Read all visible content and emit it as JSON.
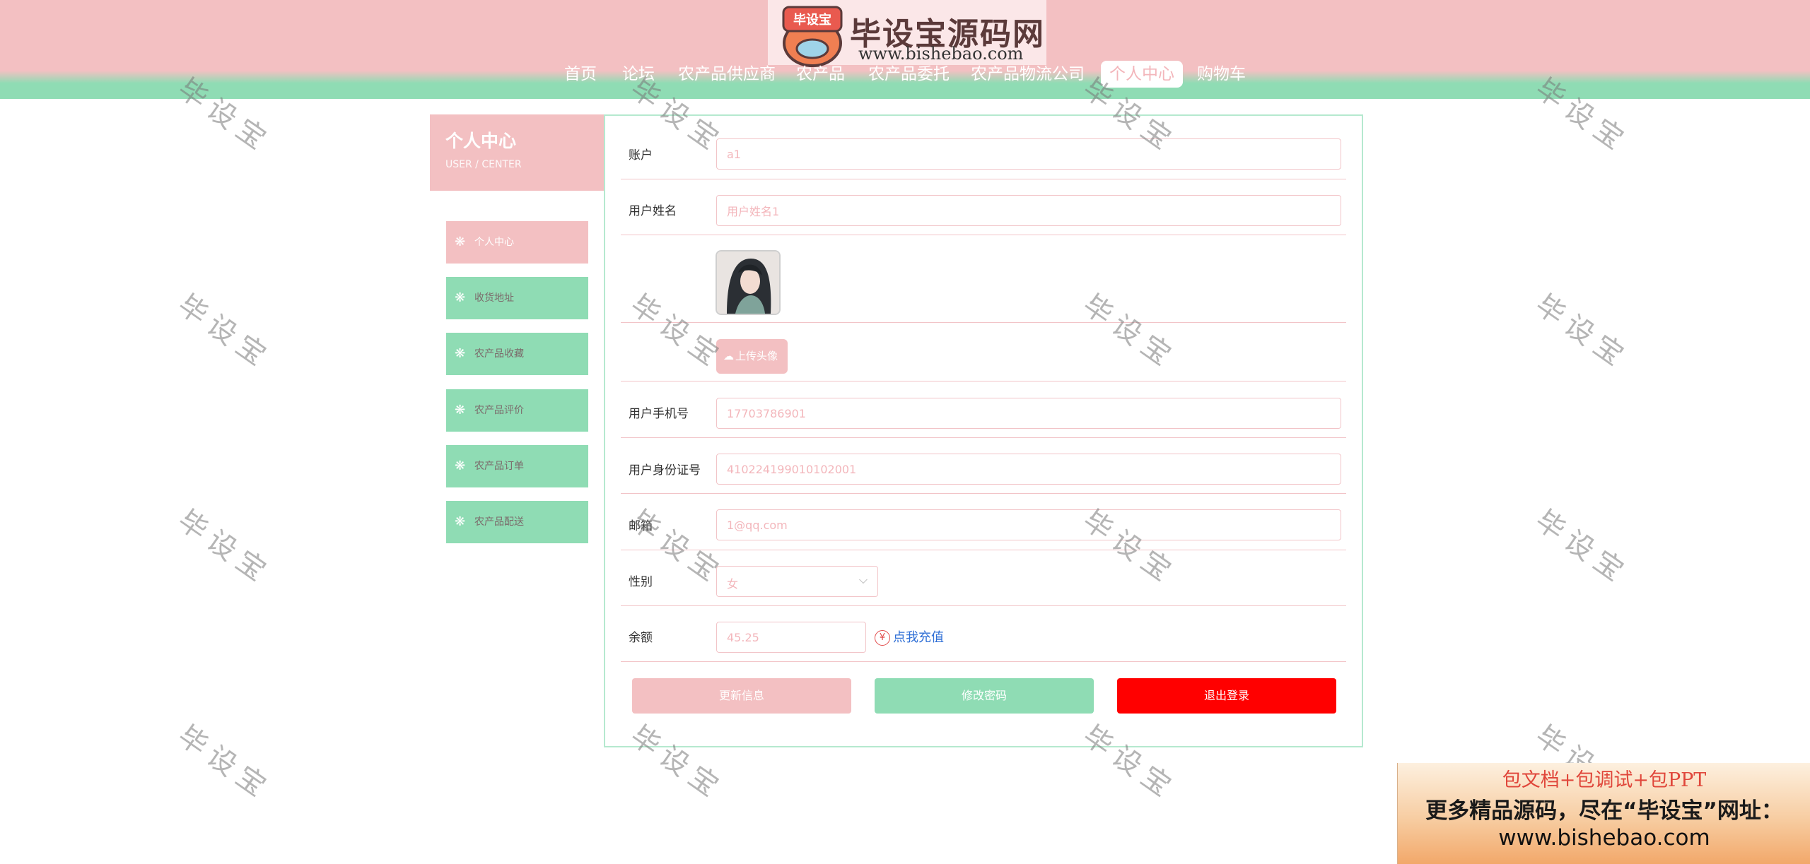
{
  "logo": {
    "emblem_text": "毕设宝",
    "title": "毕设宝源码网",
    "url": "www.bishebao.com"
  },
  "nav": {
    "items": [
      {
        "label": "首页"
      },
      {
        "label": "论坛"
      },
      {
        "label": "农产品供应商"
      },
      {
        "label": "农产品"
      },
      {
        "label": "农产品委托"
      },
      {
        "label": "农产品物流公司"
      },
      {
        "label": "个人中心",
        "active": true
      },
      {
        "label": "购物车"
      }
    ]
  },
  "sidebar": {
    "title": "个人中心",
    "subtitle": "USER / CENTER",
    "items": [
      {
        "label": "个人中心",
        "active": true
      },
      {
        "label": "收货地址"
      },
      {
        "label": "农产品收藏"
      },
      {
        "label": "农产品评价"
      },
      {
        "label": "农产品订单"
      },
      {
        "label": "农产品配送"
      }
    ]
  },
  "form": {
    "account": {
      "label": "账户",
      "value": "a1"
    },
    "username": {
      "label": "用户姓名",
      "value": "用户姓名1"
    },
    "upload": {
      "label": "上传头像"
    },
    "phone": {
      "label": "用户手机号",
      "value": "17703786901"
    },
    "id_card": {
      "label": "用户身份证号",
      "value": "410224199010102001"
    },
    "email": {
      "label": "邮箱",
      "value": "1@qq.com"
    },
    "gender": {
      "label": "性别",
      "value": "女"
    },
    "balance": {
      "label": "余额",
      "value": "45.25"
    },
    "recharge": {
      "icon": "¥",
      "label": "点我充值"
    }
  },
  "buttons": {
    "update": "更新信息",
    "change_password": "修改密码",
    "logout": "退出登录"
  },
  "watermark": "毕设宝",
  "ad": {
    "line1": "包文档+包调试+包PPT",
    "line2": "更多精品源码，尽在“毕设宝”网址：",
    "line3": "www.bishebao.com"
  },
  "colors": {
    "pink": "#f3c0c2",
    "green": "#8fdcb4",
    "logout_red": "#ff0000",
    "link_blue": "#2f6fd6"
  }
}
